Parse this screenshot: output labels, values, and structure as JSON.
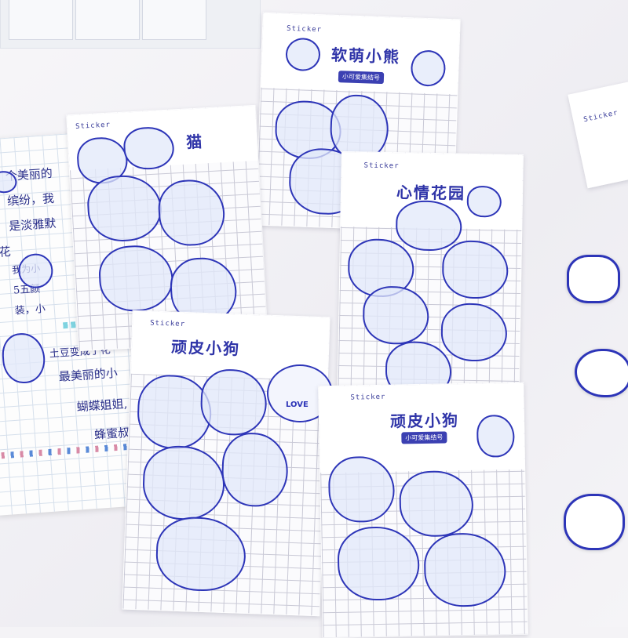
{
  "colors": {
    "ink": "#2d35b8",
    "accent": "#3b40b2",
    "paper": "#fbfbfd"
  },
  "packs": [
    {
      "sticker_word": "Sticker",
      "title": "软萌小熊",
      "subtitle": "小可爱集结号"
    },
    {
      "sticker_word": "Sticker",
      "title": "猫"
    },
    {
      "sticker_word": "Sticker",
      "title": "心情花园"
    },
    {
      "sticker_word": "Sticker",
      "title": "顽皮小狗"
    },
    {
      "sticker_word": "Sticker",
      "title": "顽皮小狗",
      "subtitle": "小可爱集结号"
    }
  ],
  "notebook_lines": [
    "个美丽的",
    "缤纷，我",
    "是淡雅默",
    "昙花",
    "我为小",
    "5五颜",
    "装，小",
    "土豆变成了花",
    "最美丽的小",
    "蝴蝶姐姐,",
    "蜂蜜叔"
  ],
  "love_text": "LOVE",
  "corner_sticker_word": "Sticker"
}
